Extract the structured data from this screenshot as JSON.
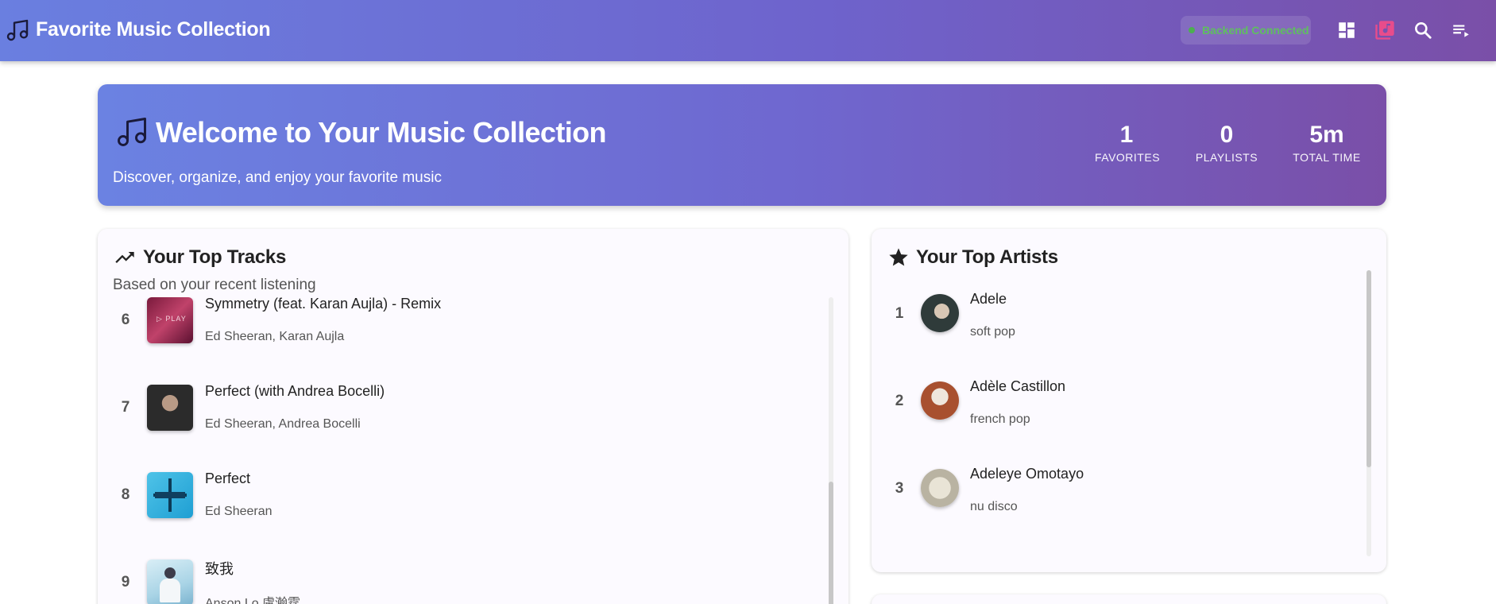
{
  "app": {
    "title": "Favorite Music Collection",
    "backend_status": "Backend Connected",
    "icons": [
      "dashboard-icon",
      "library-music-icon",
      "search-icon",
      "queue-icon"
    ]
  },
  "hero": {
    "title": "Welcome to Your Music Collection",
    "subtitle": "Discover, organize, and enjoy your favorite music",
    "stats": [
      {
        "value": "1",
        "label": "FAVORITES"
      },
      {
        "value": "0",
        "label": "PLAYLISTS"
      },
      {
        "value": "5m",
        "label": "TOTAL TIME"
      }
    ]
  },
  "top_tracks": {
    "title": "Your Top Tracks",
    "subtitle": "Based on your recent listening",
    "items": [
      {
        "rank": "6",
        "name": "Symmetry (feat. Karan Aujla) - Remix",
        "artist": "Ed Sheeran, Karan Aujla"
      },
      {
        "rank": "7",
        "name": "Perfect (with Andrea Bocelli)",
        "artist": "Ed Sheeran, Andrea Bocelli"
      },
      {
        "rank": "8",
        "name": "Perfect",
        "artist": "Ed Sheeran"
      },
      {
        "rank": "9",
        "name": "致我",
        "artist": "Anson Lo 盧瀚霆"
      }
    ]
  },
  "top_artists": {
    "title": "Your Top Artists",
    "items": [
      {
        "rank": "1",
        "name": "Adele",
        "genre": "soft pop"
      },
      {
        "rank": "2",
        "name": "Adèle Castillon",
        "genre": "french pop"
      },
      {
        "rank": "3",
        "name": "Adeleye Omotayo",
        "genre": "nu disco"
      }
    ]
  },
  "colors": {
    "accent": "#6e63cc",
    "status_green": "#4caf50",
    "active_icon": "#e84c8b"
  }
}
